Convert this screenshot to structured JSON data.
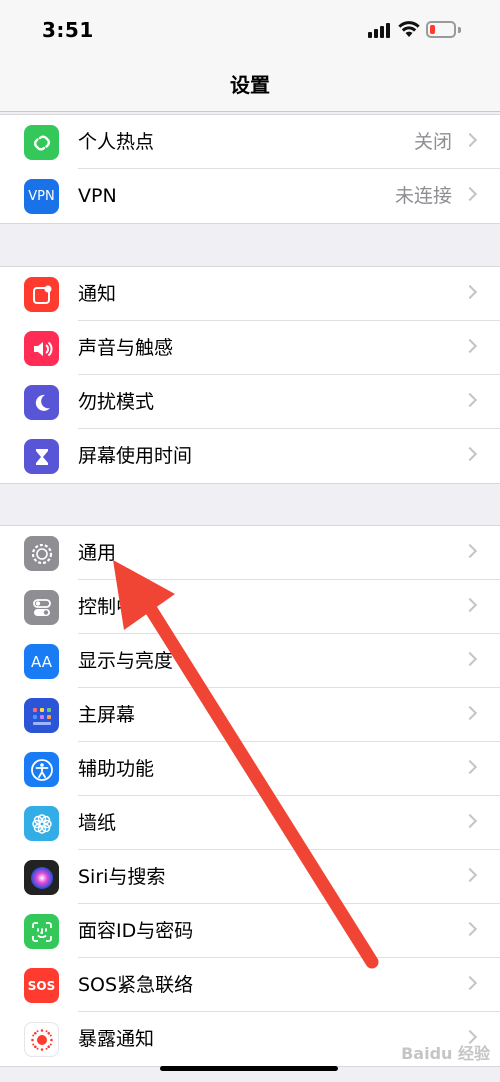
{
  "status_bar": {
    "time": "3:51"
  },
  "nav": {
    "title": "设置"
  },
  "groups": [
    {
      "items": [
        {
          "key": "hotspot",
          "label": "个人热点",
          "value": "关闭",
          "icon": "link-icon",
          "color": "#34c759"
        },
        {
          "key": "vpn",
          "label": "VPN",
          "value": "未连接",
          "icon": "vpn-icon",
          "icon_text": "VPN",
          "color": "#1a72e8"
        }
      ]
    },
    {
      "items": [
        {
          "key": "notifications",
          "label": "通知",
          "icon": "notification-icon",
          "color": "#ff3b30"
        },
        {
          "key": "sounds",
          "label": "声音与触感",
          "icon": "speaker-icon",
          "color": "#ff2d55"
        },
        {
          "key": "dnd",
          "label": "勿扰模式",
          "icon": "moon-icon",
          "color": "#5856d6"
        },
        {
          "key": "screen_time",
          "label": "屏幕使用时间",
          "icon": "hourglass-icon",
          "color": "#5856d6"
        }
      ]
    },
    {
      "items": [
        {
          "key": "general",
          "label": "通用",
          "icon": "gear-icon",
          "color": "#8e8e93"
        },
        {
          "key": "control_center",
          "label": "控制中心",
          "icon": "toggles-icon",
          "color": "#8e8e93"
        },
        {
          "key": "display",
          "label": "显示与亮度",
          "icon": "text-size-icon",
          "icon_text": "AA",
          "color": "#1a7cf5"
        },
        {
          "key": "home_screen",
          "label": "主屏幕",
          "icon": "app-grid-icon",
          "color": "#2c54d6"
        },
        {
          "key": "accessibility",
          "label": "辅助功能",
          "icon": "accessibility-icon",
          "color": "#1a7cf5"
        },
        {
          "key": "wallpaper",
          "label": "墙纸",
          "icon": "flower-icon",
          "color": "#32ade6"
        },
        {
          "key": "siri",
          "label": "Siri与搜索",
          "icon": "siri-icon",
          "color": "#222222"
        },
        {
          "key": "face_id",
          "label": "面容ID与密码",
          "icon": "face-id-icon",
          "color": "#34c759"
        },
        {
          "key": "sos",
          "label": "SOS紧急联络",
          "icon": "sos-icon",
          "icon_text": "SOS",
          "color": "#ff3b30"
        },
        {
          "key": "exposure",
          "label": "暴露通知",
          "icon": "exposure-icon",
          "color": "#ffffff"
        }
      ]
    }
  ],
  "watermark": "Baidu 经验"
}
